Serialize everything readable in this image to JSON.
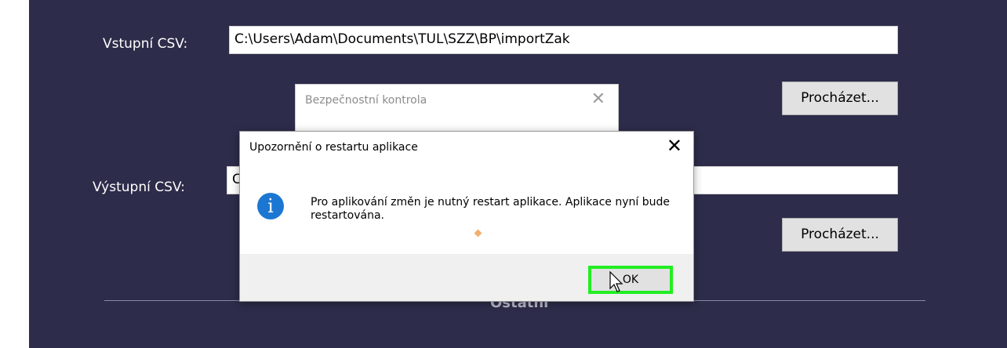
{
  "form": {
    "input_label": "Vstupní CSV:",
    "input_value": "C:\\Users\\Adam\\Documents\\TUL\\SZZ\\BP\\importZak",
    "browse_label_1": "Procházet...",
    "output_label": "Výstupní CSV:",
    "output_value": "C",
    "browse_label_2": "Procházet...",
    "section_title": "Ostatní"
  },
  "security_dialog": {
    "title": "Bezpečnostní kontrola",
    "close_glyph": "✕"
  },
  "message_box": {
    "title": "Upozornění o restartu aplikace",
    "close_glyph": "✕",
    "icon_glyph": "i",
    "icon": "info-icon",
    "message": "Pro aplikování změn je nutný restart aplikace. Aplikace nyní bude restartována.",
    "ok_label": "OK"
  },
  "colors": {
    "app_background": "#2d2c4a",
    "ok_highlight": "#22ee22",
    "info_icon": "#1c77d2"
  }
}
